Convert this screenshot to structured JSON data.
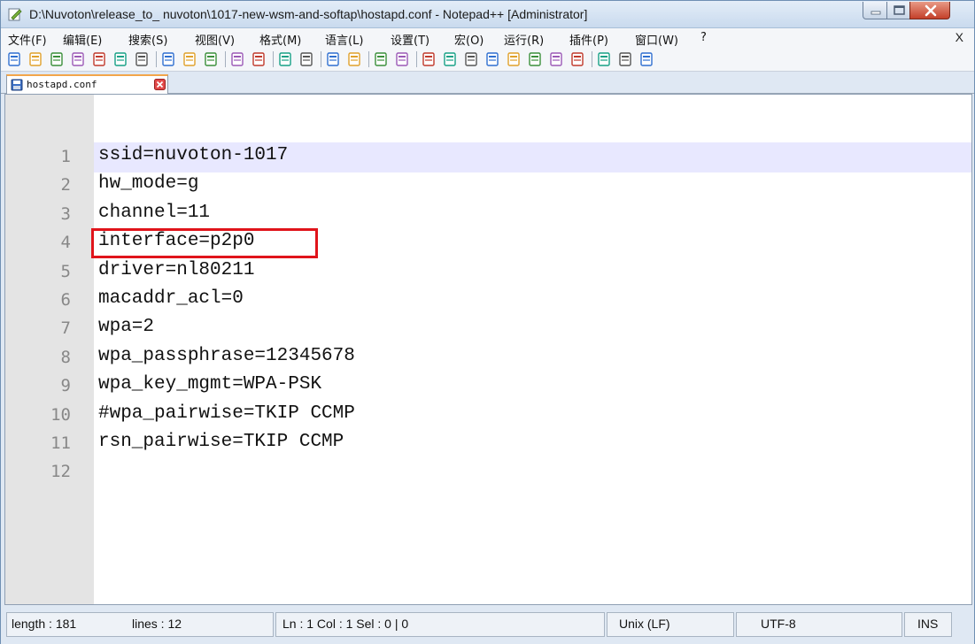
{
  "window": {
    "title": "D:\\Nuvoton\\release_to_ nuvoton\\1017-new-wsm-and-softap\\hostapd.conf - Notepad++ [Administrator]"
  },
  "menu": {
    "items": [
      {
        "label": "文件(F)",
        "icon": null
      },
      {
        "label": "编辑(E)"
      },
      {
        "label": "搜索(S)"
      },
      {
        "label": "视图(V)"
      },
      {
        "label": "格式(M)"
      },
      {
        "label": "语言(L)"
      },
      {
        "label": "设置(T)"
      },
      {
        "label": "宏(O)"
      },
      {
        "label": "运行(R)"
      },
      {
        "label": "插件(P)"
      },
      {
        "label": "窗口(W)"
      },
      {
        "label": "?"
      }
    ],
    "close_label": "X"
  },
  "toolbar": {
    "icons": [
      "new-file-icon",
      "open-file-icon",
      "save-icon",
      "save-all-icon",
      "close-icon",
      "close-all-icon",
      "print-icon",
      "cut-icon",
      "copy-icon",
      "paste-icon",
      "undo-icon",
      "redo-icon",
      "find-icon",
      "replace-icon",
      "zoom-in-icon",
      "zoom-out-icon",
      "sync-v-icon",
      "sync-h-icon",
      "word-wrap-icon",
      "show-all-chars-icon",
      "indent-guide-icon",
      "udl-icon",
      "doc-map-icon",
      "function-list-icon",
      "folder-workspace-icon",
      "monitor-icon",
      "record-macro-icon",
      "stop-macro-icon",
      "play-macro-icon"
    ]
  },
  "tab": {
    "label": "hostapd.conf"
  },
  "editor": {
    "lines": [
      {
        "n": "1",
        "text": "ssid=nuvoton-1017"
      },
      {
        "n": "2",
        "text": "hw_mode=g"
      },
      {
        "n": "3",
        "text": "channel=11"
      },
      {
        "n": "4",
        "text": "interface=p2p0"
      },
      {
        "n": "5",
        "text": "driver=nl80211"
      },
      {
        "n": "6",
        "text": "macaddr_acl=0"
      },
      {
        "n": "7",
        "text": "wpa=2"
      },
      {
        "n": "8",
        "text": "wpa_passphrase=12345678"
      },
      {
        "n": "9",
        "text": "wpa_key_mgmt=WPA-PSK"
      },
      {
        "n": "10",
        "text": "#wpa_pairwise=TKIP CCMP"
      },
      {
        "n": "11",
        "text": "rsn_pairwise=TKIP CCMP"
      },
      {
        "n": "12",
        "text": ""
      }
    ],
    "highlight_color": "#e0141b"
  },
  "status": {
    "length": "length : 181",
    "lines": "lines : 12",
    "position": "Ln : 1    Col : 1    Sel : 0 | 0",
    "eol": "Unix (LF)",
    "encoding": "UTF-8",
    "mode": "INS"
  }
}
